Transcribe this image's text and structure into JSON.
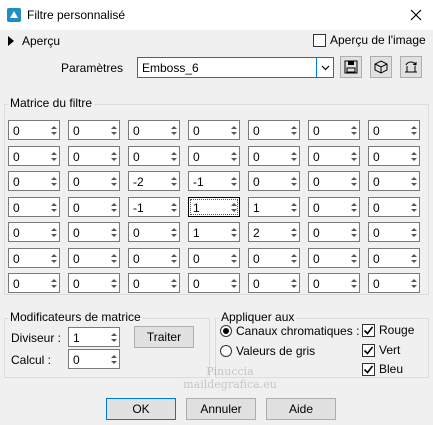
{
  "window": {
    "title": "Filtre personnalisé"
  },
  "preview": {
    "label": "Aperçu",
    "image_preview_label": "Aperçu de l'image",
    "image_preview_checked": false
  },
  "params": {
    "label": "Paramètres",
    "value": "Emboss_6"
  },
  "matrix": {
    "title": "Matrice du filtre",
    "rows": [
      [
        "0",
        "0",
        "0",
        "0",
        "0",
        "0",
        "0"
      ],
      [
        "0",
        "0",
        "0",
        "0",
        "0",
        "0",
        "0"
      ],
      [
        "0",
        "0",
        "-2",
        "-1",
        "0",
        "0",
        "0"
      ],
      [
        "0",
        "0",
        "-1",
        "1",
        "1",
        "0",
        "0"
      ],
      [
        "0",
        "0",
        "0",
        "1",
        "2",
        "0",
        "0"
      ],
      [
        "0",
        "0",
        "0",
        "0",
        "0",
        "0",
        "0"
      ],
      [
        "0",
        "0",
        "0",
        "0",
        "0",
        "0",
        "0"
      ]
    ]
  },
  "modifiers": {
    "title": "Modificateurs de matrice",
    "divisor_label": "Diviseur :",
    "divisor_value": "1",
    "bias_label": "Calcul :",
    "bias_value": "0",
    "process_label": "Traiter"
  },
  "apply": {
    "title": "Appliquer aux",
    "channels_label": "Canaux chromatiques :",
    "grayscale_label": "Valeurs de gris",
    "selected": "channels",
    "red": "Rouge",
    "green": "Vert",
    "blue": "Bleu"
  },
  "buttons": {
    "ok": "OK",
    "cancel": "Annuler",
    "help": "Aide"
  },
  "watermark": {
    "line1": "Pinuccia",
    "line2": "maildegrafica.eu"
  },
  "colors": {
    "accent": "#0078d7",
    "icon_teal": "#1e8fc0"
  }
}
